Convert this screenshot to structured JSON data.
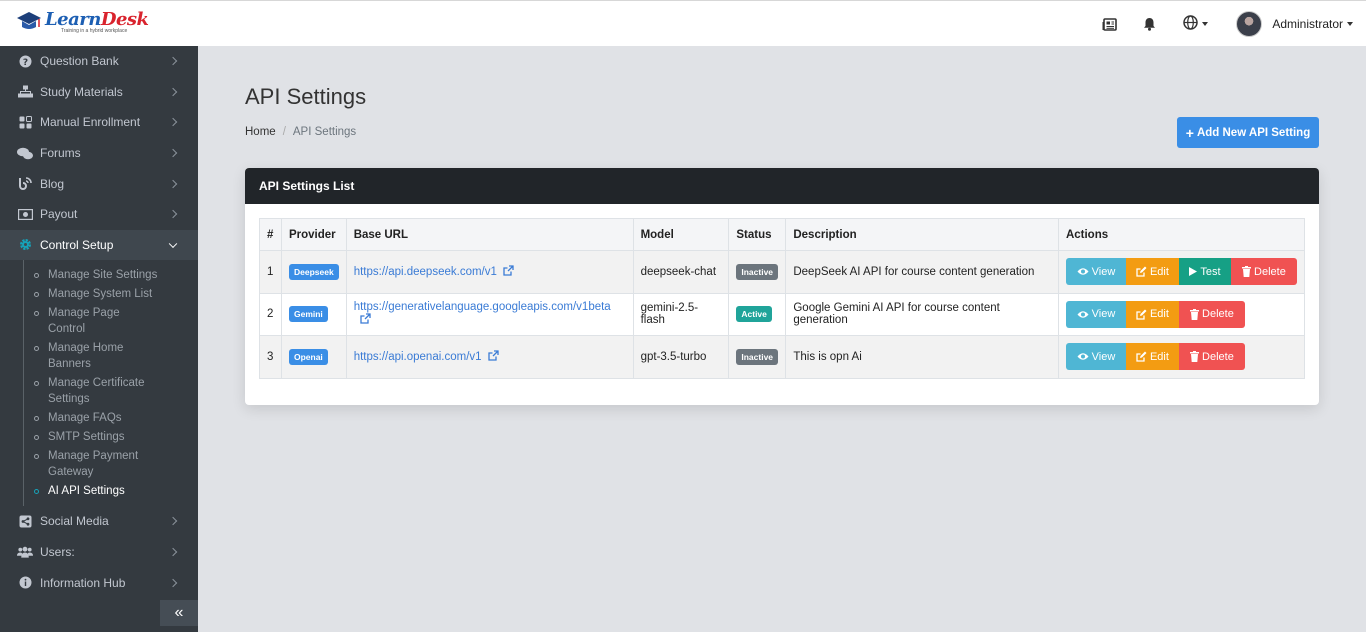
{
  "app": {
    "brand_part1": "Learn",
    "brand_part2": "Desk",
    "tagline": "Training in a hybrid workplace"
  },
  "topbar": {
    "user_name": "Administrator",
    "icons": [
      "news-icon",
      "bell-icon",
      "globe-icon"
    ]
  },
  "sidebar": {
    "items_top": [
      {
        "label": "Question Bank",
        "icon": "question-circle-icon"
      },
      {
        "label": "Study Materials",
        "icon": "sitemap-icon"
      },
      {
        "label": "Manual Enrollment",
        "icon": "grid-icon"
      },
      {
        "label": "Forums",
        "icon": "comments-icon"
      },
      {
        "label": "Blog",
        "icon": "blog-icon"
      },
      {
        "label": "Payout",
        "icon": "money-icon"
      },
      {
        "label": "Control Setup",
        "icon": "gear-icon"
      }
    ],
    "sub_items": [
      "Manage Site Settings",
      "Manage System List",
      "Manage Page Control",
      "Manage Home Banners",
      "Manage Certificate Settings",
      "Manage FAQs",
      "SMTP Settings",
      "Manage Payment Gateway",
      "AI API Settings"
    ],
    "items_bottom": [
      {
        "label": "Social Media",
        "icon": "share-icon"
      },
      {
        "label": "Users:",
        "icon": "users-icon"
      },
      {
        "label": "Information Hub",
        "icon": "info-icon"
      }
    ],
    "collapse_label": "«"
  },
  "page": {
    "title": "API Settings",
    "breadcrumb_home": "Home",
    "breadcrumb_sep": "/",
    "breadcrumb_current": "API Settings",
    "add_button": "Add New API Setting",
    "card_title": "API Settings List"
  },
  "table": {
    "headers": [
      "#",
      "Provider",
      "Base URL",
      "Model",
      "Status",
      "Description",
      "Actions"
    ],
    "rows": [
      {
        "num": "1",
        "provider": "Deepseek",
        "url": "https://api.deepseek.com/v1",
        "model": "deepseek-chat",
        "status": "Inactive",
        "description": "DeepSeek AI API for course content generation"
      },
      {
        "num": "2",
        "provider": "Gemini",
        "url": "https://generativelanguage.googleapis.com/v1beta",
        "model": "gemini-2.5-flash",
        "status": "Active",
        "description": "Google Gemini AI API for course content generation"
      },
      {
        "num": "3",
        "provider": "Openai",
        "url": "https://api.openai.com/v1",
        "model": "gpt-3.5-turbo",
        "status": "Inactive",
        "description": "This is opn Ai"
      }
    ],
    "actions": {
      "view": "View",
      "edit": "Edit",
      "test": "Test",
      "delete": "Delete"
    }
  },
  "colors": {
    "primary": "#3a8ee6",
    "sidebar": "#343a40",
    "view": "#4fb6d4",
    "edit": "#f39c12",
    "test": "#16a085",
    "delete": "#f05252",
    "active": "#20a49a",
    "inactive": "#6c757d"
  }
}
